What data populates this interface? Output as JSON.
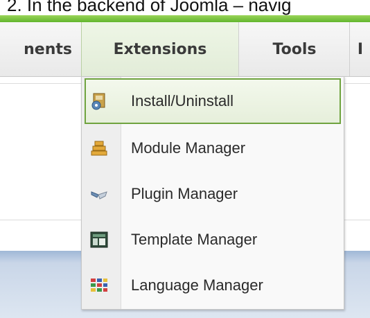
{
  "caption": "2. In the backend of Joomla – navig",
  "tabs": [
    {
      "label": "nents"
    },
    {
      "label": "Extensions"
    },
    {
      "label": "Tools"
    },
    {
      "label": "I"
    }
  ],
  "menu": {
    "items": [
      {
        "label": "Install/Uninstall",
        "icon": "install-box-icon"
      },
      {
        "label": "Module Manager",
        "icon": "module-stack-icon"
      },
      {
        "label": "Plugin Manager",
        "icon": "plugin-icon"
      },
      {
        "label": "Template Manager",
        "icon": "template-icon"
      },
      {
        "label": "Language Manager",
        "icon": "language-flags-icon"
      }
    ]
  },
  "colors": {
    "accent_green": "#62b52e",
    "active_border": "#6fa33f",
    "bottom_bar_blue": "#9fb7d6"
  }
}
